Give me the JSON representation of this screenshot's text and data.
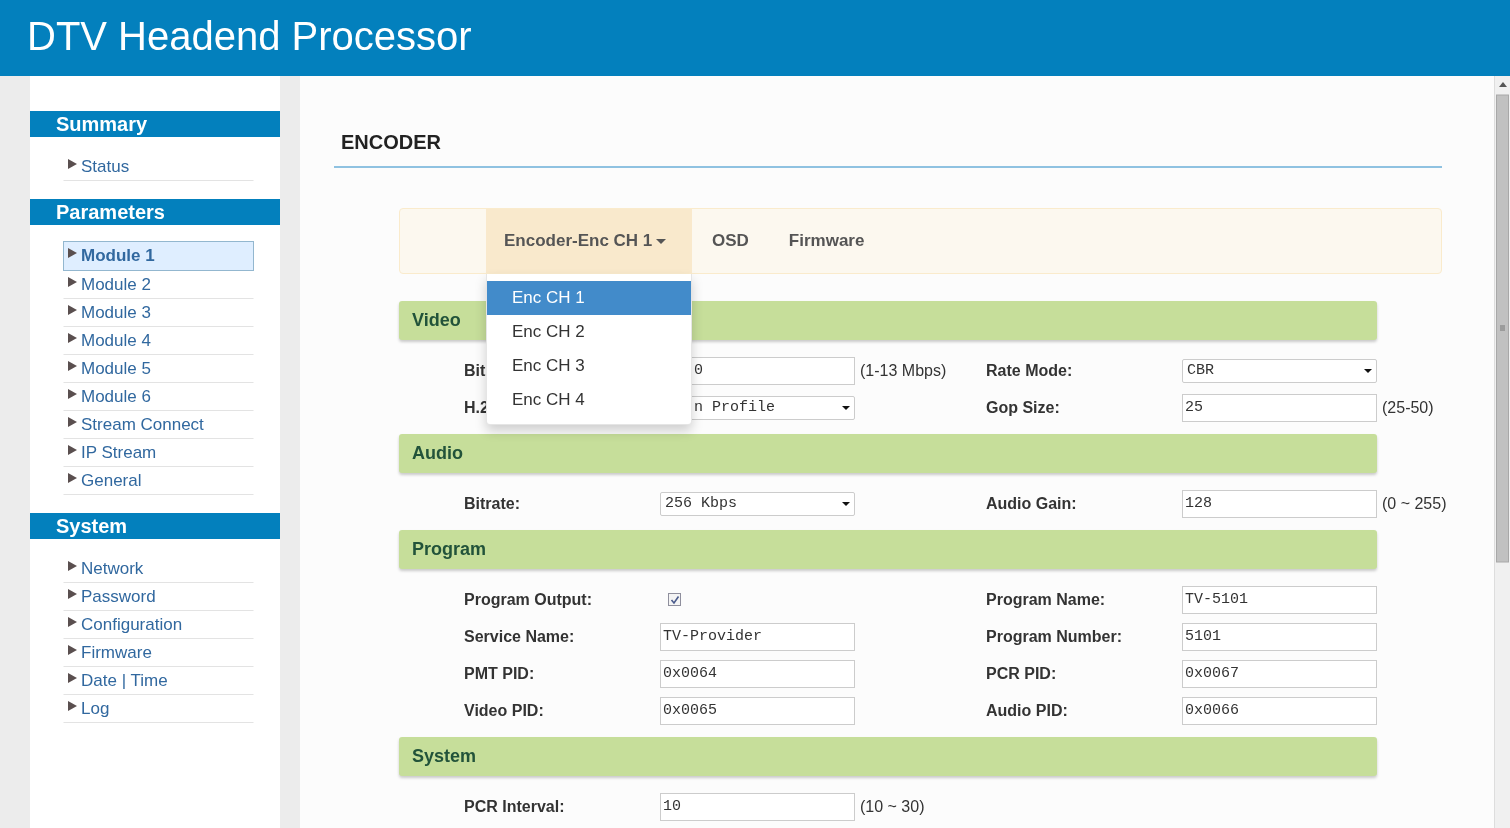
{
  "header": {
    "title": "DTV Headend Processor"
  },
  "sidebar": {
    "groups": [
      {
        "title": "Summary",
        "items": [
          {
            "label": "Status",
            "selected": false
          }
        ]
      },
      {
        "title": "Parameters",
        "items": [
          {
            "label": "Module 1",
            "selected": true
          },
          {
            "label": "Module 2",
            "selected": false
          },
          {
            "label": "Module 3",
            "selected": false
          },
          {
            "label": "Module 4",
            "selected": false
          },
          {
            "label": "Module 5",
            "selected": false
          },
          {
            "label": "Module 6",
            "selected": false
          },
          {
            "label": "Stream Connect",
            "selected": false
          },
          {
            "label": "IP Stream",
            "selected": false
          },
          {
            "label": "General",
            "selected": false
          }
        ]
      },
      {
        "title": "System",
        "items": [
          {
            "label": "Network",
            "selected": false
          },
          {
            "label": "Password",
            "selected": false
          },
          {
            "label": "Configuration",
            "selected": false
          },
          {
            "label": "Firmware",
            "selected": false
          },
          {
            "label": "Date | Time",
            "selected": false
          },
          {
            "label": "Log",
            "selected": false
          }
        ]
      }
    ]
  },
  "page": {
    "title": "ENCODER"
  },
  "tabs": [
    {
      "label": "Encoder-Enc CH 1",
      "selected": true,
      "dropdown": true
    },
    {
      "label": "OSD",
      "selected": false,
      "dropdown": false
    },
    {
      "label": "Firmware",
      "selected": false,
      "dropdown": false
    }
  ],
  "dropdown_menu": {
    "items": [
      {
        "label": "Enc CH 1",
        "selected": true
      },
      {
        "label": "Enc CH 2",
        "selected": false
      },
      {
        "label": "Enc CH 3",
        "selected": false
      },
      {
        "label": "Enc CH 4",
        "selected": false
      }
    ]
  },
  "sections": [
    {
      "title": "Video",
      "rows": [
        {
          "left": {
            "label": "Bit",
            "kind": "text",
            "value": "0",
            "hint": "(1-13 Mbps)"
          },
          "right": {
            "label": "Rate Mode:",
            "kind": "select",
            "value": "CBR"
          }
        },
        {
          "left": {
            "label": "H.2",
            "kind": "select",
            "value": "n Profile"
          },
          "right": {
            "label": "Gop Size:",
            "kind": "text",
            "value": "25",
            "hint": "(25-50)"
          }
        }
      ]
    },
    {
      "title": "Audio",
      "rows": [
        {
          "left": {
            "label": "Bitrate:",
            "kind": "select",
            "value": "256 Kbps"
          },
          "right": {
            "label": "Audio Gain:",
            "kind": "text",
            "value": "128",
            "hint": "(0 ~ 255)"
          }
        }
      ]
    },
    {
      "title": "Program",
      "rows": [
        {
          "left": {
            "label": "Program Output:",
            "kind": "checkbox",
            "checked": true
          },
          "right": {
            "label": "Program Name:",
            "kind": "text",
            "value": "TV-5101"
          }
        },
        {
          "left": {
            "label": "Service Name:",
            "kind": "text",
            "value": "TV-Provider"
          },
          "right": {
            "label": "Program Number:",
            "kind": "text",
            "value": "5101"
          }
        },
        {
          "left": {
            "label": "PMT PID:",
            "kind": "text",
            "value": "0x0064"
          },
          "right": {
            "label": "PCR PID:",
            "kind": "text",
            "value": "0x0067"
          }
        },
        {
          "left": {
            "label": "Video PID:",
            "kind": "text",
            "value": "0x0065"
          },
          "right": {
            "label": "Audio PID:",
            "kind": "text",
            "value": "0x0066"
          }
        }
      ]
    },
    {
      "title": "System",
      "rows": [
        {
          "left": {
            "label": "PCR Interval:",
            "kind": "text",
            "value": "10",
            "hint": "(10 ~ 30)"
          }
        }
      ]
    }
  ]
}
